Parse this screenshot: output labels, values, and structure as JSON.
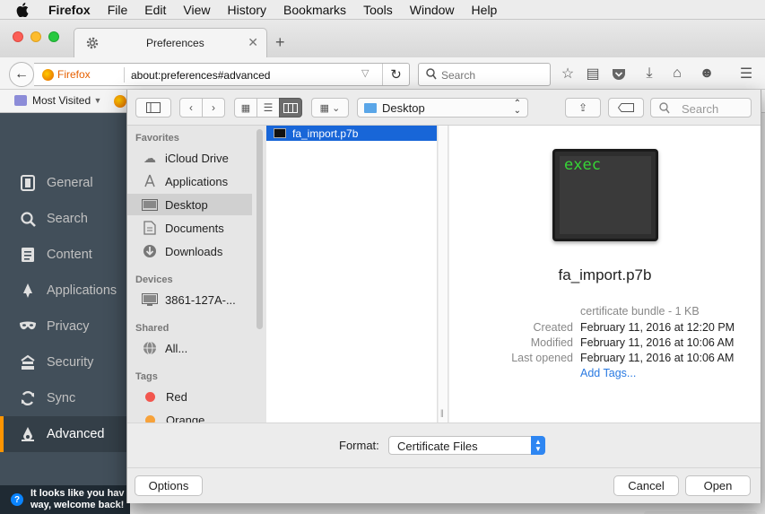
{
  "menubar": {
    "app_name": "Firefox",
    "items": [
      "File",
      "Edit",
      "View",
      "History",
      "Bookmarks",
      "Tools",
      "Window",
      "Help"
    ]
  },
  "browser": {
    "tab": {
      "title": "Preferences"
    },
    "identity_label": "Firefox",
    "url": "about:preferences#advanced",
    "search_placeholder": "Search",
    "bookmarks": {
      "most_visited": "Most Visited"
    }
  },
  "sidebar": {
    "items": [
      {
        "label": "General",
        "icon": "general-icon"
      },
      {
        "label": "Search",
        "icon": "search-icon"
      },
      {
        "label": "Content",
        "icon": "content-icon"
      },
      {
        "label": "Applications",
        "icon": "applications-icon"
      },
      {
        "label": "Privacy",
        "icon": "privacy-mask-icon"
      },
      {
        "label": "Security",
        "icon": "security-icon"
      },
      {
        "label": "Sync",
        "icon": "sync-icon"
      },
      {
        "label": "Advanced",
        "icon": "advanced-icon"
      }
    ],
    "active": "Advanced",
    "notification": "It looks like you hav\nway, welcome back!"
  },
  "dialog": {
    "location": "Desktop",
    "search_placeholder": "Search",
    "favorites_header": "Favorites",
    "favorites": [
      "iCloud Drive",
      "Applications",
      "Desktop",
      "Documents",
      "Downloads"
    ],
    "devices_header": "Devices",
    "devices": [
      "3861-127A-..."
    ],
    "shared_header": "Shared",
    "shared": [
      "All..."
    ],
    "tags_header": "Tags",
    "tags": [
      {
        "label": "Red",
        "color": "#f2564e"
      },
      {
        "label": "Orange",
        "color": "#f7a23a"
      }
    ],
    "files": [
      "fa_import.p7b"
    ],
    "preview": {
      "icon_text": "exec",
      "filename": "fa_import.p7b",
      "kind": "certificate bundle - 1 KB",
      "created_label": "Created",
      "created": "February 11, 2016 at 12:20 PM",
      "modified_label": "Modified",
      "modified": "February 11, 2016 at 10:06 AM",
      "last_opened_label": "Last opened",
      "last_opened": "February 11, 2016 at 10:06 AM",
      "add_tags": "Add Tags..."
    },
    "format_label": "Format:",
    "format_value": "Certificate Files",
    "options_button": "Options",
    "cancel_button": "Cancel",
    "open_button": "Open"
  },
  "colors": {
    "accent_blue": "#1866d8",
    "sidebar_bg": "#424f5a",
    "active_indicator": "#ff9500",
    "exec_text": "#36d636"
  }
}
